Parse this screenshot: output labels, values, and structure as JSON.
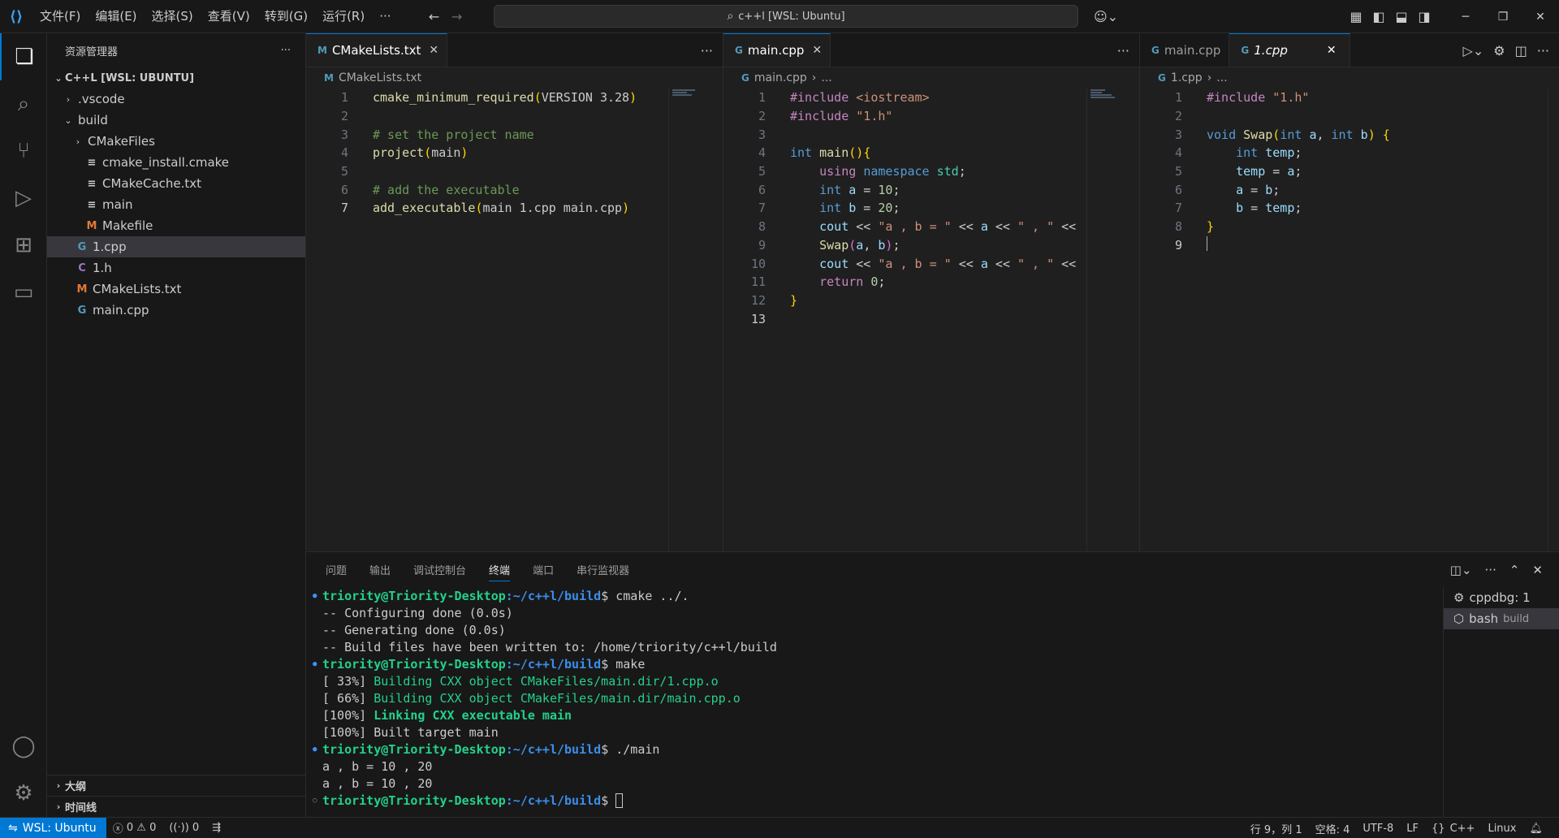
{
  "titlebar": {
    "menu": [
      "文件(F)",
      "编辑(E)",
      "选择(S)",
      "查看(V)",
      "转到(G)",
      "运行(R)",
      "···"
    ],
    "search": "c++l [WSL: Ubuntu]"
  },
  "sidebar": {
    "title": "资源管理器",
    "root": "C++L [WSL: UBUNTU]",
    "items": [
      {
        "label": ".vscode",
        "depth": 1,
        "chev": "›",
        "icon": ""
      },
      {
        "label": "build",
        "depth": 1,
        "chev": "⌄",
        "icon": ""
      },
      {
        "label": "CMakeFiles",
        "depth": 2,
        "chev": "›",
        "icon": ""
      },
      {
        "label": "cmake_install.cmake",
        "depth": 2,
        "chev": "",
        "icon": "≡"
      },
      {
        "label": "CMakeCache.txt",
        "depth": 2,
        "chev": "",
        "icon": "≡"
      },
      {
        "label": "main",
        "depth": 2,
        "chev": "",
        "icon": "≡"
      },
      {
        "label": "Makefile",
        "depth": 2,
        "chev": "",
        "icon": "M"
      },
      {
        "label": "1.cpp",
        "depth": 1,
        "chev": "",
        "icon": "G"
      },
      {
        "label": "1.h",
        "depth": 1,
        "chev": "",
        "icon": "C"
      },
      {
        "label": "CMakeLists.txt",
        "depth": 1,
        "chev": "",
        "icon": "M"
      },
      {
        "label": "main.cpp",
        "depth": 1,
        "chev": "",
        "icon": "G"
      }
    ],
    "outline": "大纲",
    "timeline": "时间线"
  },
  "editors": {
    "g1": {
      "tab": "CMakeLists.txt",
      "crumb": "CMakeLists.txt"
    },
    "g2": {
      "tab": "main.cpp",
      "crumb": "main.cpp",
      "crumb_more": "..."
    },
    "g3": {
      "tab1": "main.cpp",
      "tab2": "1.cpp",
      "crumb": "1.cpp",
      "crumb_more": "..."
    }
  },
  "panel": {
    "tabs": [
      "问题",
      "输出",
      "调试控制台",
      "终端",
      "端口",
      "串行监视器"
    ],
    "terminals": [
      {
        "name": "cppdbg: 1",
        "sub": ""
      },
      {
        "name": "bash",
        "sub": "build"
      }
    ],
    "prompt_user": "triority@Triority-Desktop",
    "prompt_path": ":~/c++l/build"
  },
  "statusbar": {
    "remote": "WSL: Ubuntu",
    "errors": "0",
    "warnings": "0",
    "ports": "0",
    "position": "行 9，列 1",
    "spaces": "空格: 4",
    "encoding": "UTF-8",
    "eol": "LF",
    "language": "C++",
    "platform": "Linux"
  },
  "colors": {
    "accent": "#0078d4",
    "prompt_green": "#23d18b",
    "prompt_blue": "#3b8eea"
  }
}
